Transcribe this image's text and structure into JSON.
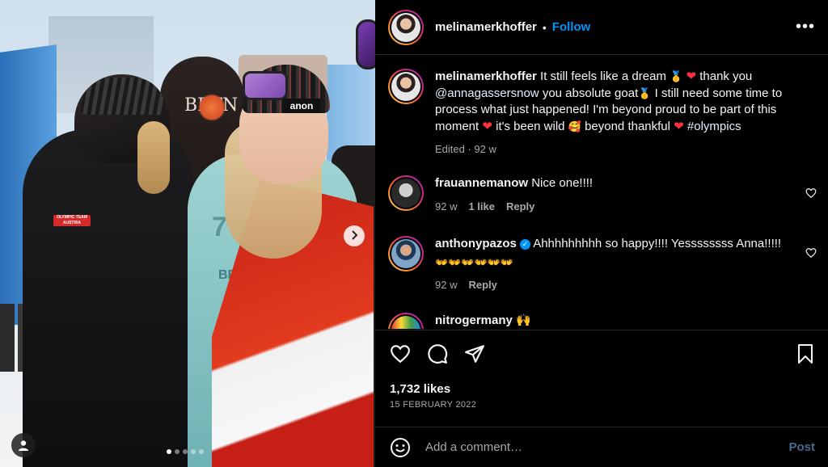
{
  "photo": {
    "board_text": "BRTN",
    "badge_text": "OLYMPIC TEAM AUSTRIA",
    "goggle_brand": "anon",
    "bib_number": "7",
    "bib_text": "BEIJING 2022",
    "carousel_total": 5,
    "carousel_active_index": 0
  },
  "header": {
    "username": "melinamerkhoffer",
    "dot": "•",
    "follow_label": "Follow",
    "more_label": "•••"
  },
  "caption": {
    "username": "melinamerkhoffer",
    "text1": "It still feels like a dream",
    "text2": "thank you",
    "mention": "@annagassersnow",
    "text3": "you absolute goat",
    "text4": "I still need some time to process what just happened! I'm beyond proud to be part of this moment",
    "text5": "it's been wild",
    "text6": "beyond thankful",
    "hashtag": "#olympics",
    "time": "Edited · 92 w"
  },
  "comments": [
    {
      "username": "frauannemanow",
      "text": "Nice one!!!!",
      "time": "92 w",
      "likes": "1 like",
      "reply": "Reply"
    },
    {
      "username": "anthonypazos",
      "text": "Ahhhhhhhhh so happy!!!! Yessssssss Anna!!!!!",
      "emoji_line": "👐👐👐👐👐👐",
      "time": "92 w",
      "reply": "Reply"
    },
    {
      "username": "nitrogermany",
      "text": "🙌"
    }
  ],
  "post": {
    "likes": "1,732 likes",
    "date": "15 FEBRUARY 2022"
  },
  "add_comment": {
    "placeholder": "Add a comment…",
    "post_label": "Post"
  },
  "colors": {
    "follow": "#0095f6",
    "heart": "#ff3040",
    "muted": "#a8a8a8",
    "background": "#000000"
  }
}
